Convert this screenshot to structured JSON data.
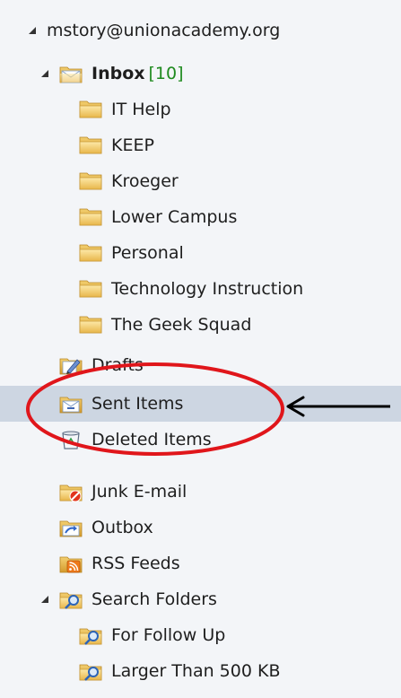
{
  "tree": {
    "account": {
      "label": "mstory@unionacademy.org"
    },
    "inbox": {
      "label": "Inbox",
      "count": "[10]"
    },
    "inbox_children": [
      {
        "label": "IT Help"
      },
      {
        "label": "KEEP"
      },
      {
        "label": "Kroeger"
      },
      {
        "label": "Lower Campus"
      },
      {
        "label": "Personal"
      },
      {
        "label": "Technology Instruction"
      },
      {
        "label": "The Geek Squad"
      }
    ],
    "drafts": {
      "label": "Drafts"
    },
    "sent_items": {
      "label": "Sent Items",
      "selected": true
    },
    "deleted_items": {
      "label": "Deleted Items"
    },
    "junk": {
      "label": "Junk E-mail"
    },
    "outbox": {
      "label": "Outbox"
    },
    "rss": {
      "label": "RSS Feeds"
    },
    "search_folders": {
      "label": "Search Folders"
    },
    "search_children": [
      {
        "label": "For Follow Up"
      },
      {
        "label": "Larger Than 500 KB"
      }
    ]
  },
  "colors": {
    "selection": "#cdd6e2",
    "unread_count": "#1f8a1f",
    "annotation_circle": "#e0161b",
    "annotation_arrow": "#000000"
  }
}
